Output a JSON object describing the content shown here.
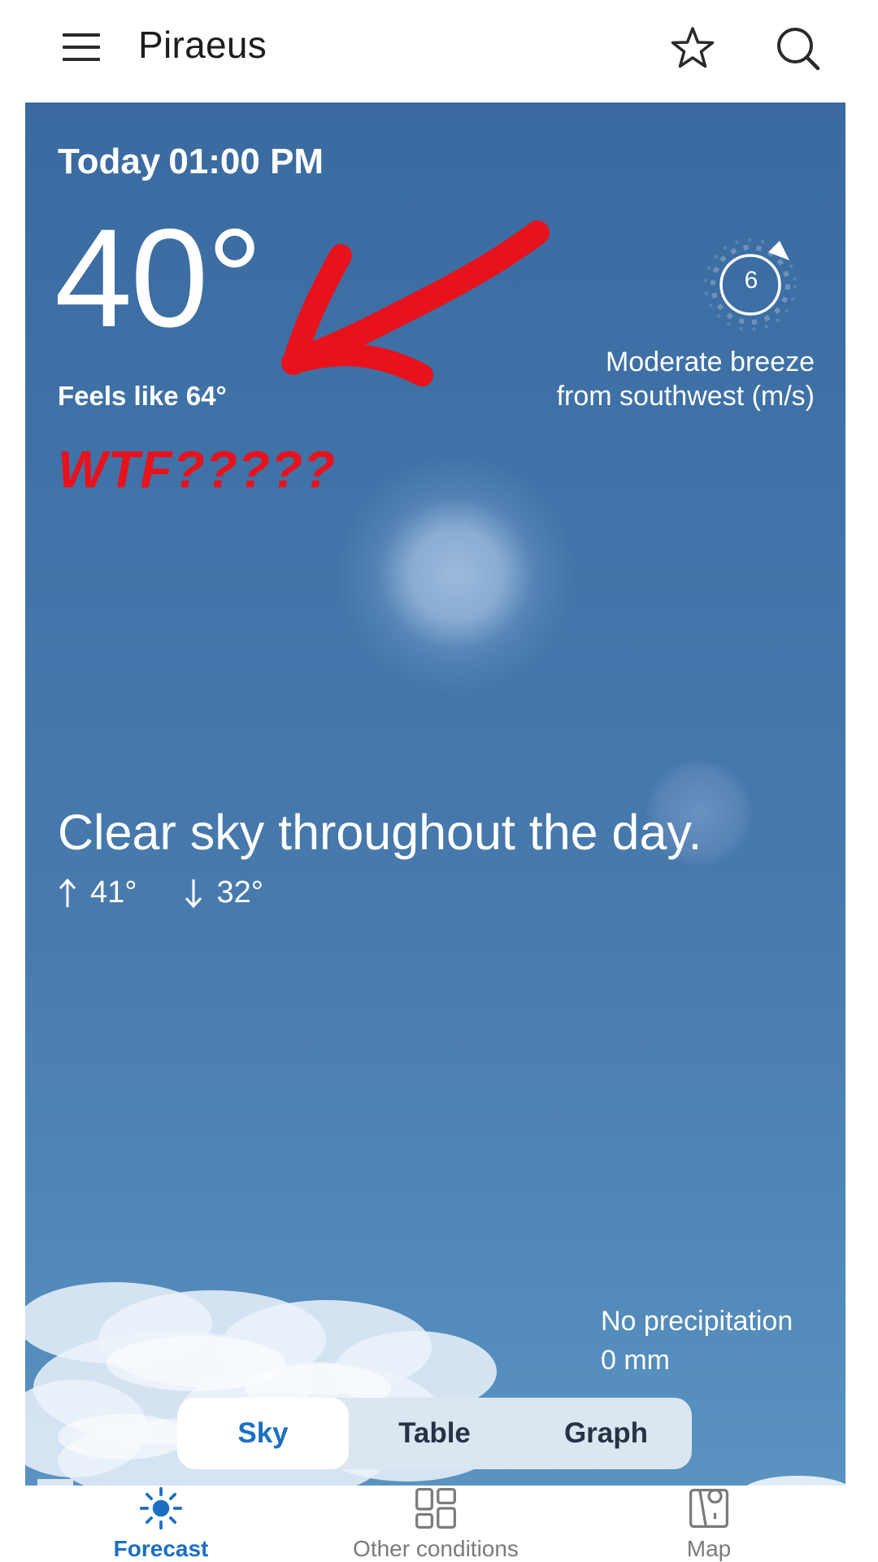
{
  "header": {
    "location": "Piraeus",
    "menu_icon": "hamburger-menu-icon",
    "favorite_icon": "star-outline-icon",
    "search_icon": "search-icon"
  },
  "current": {
    "day": "Today",
    "time": "01:00 PM",
    "temperature": "40°",
    "feels_like": "Feels like 64°",
    "wind": {
      "speed": "6",
      "description_line1": "Moderate breeze",
      "description_line2": "from southwest (m/s)"
    }
  },
  "annotation": {
    "text": "WTF?????",
    "color": "#e8121c"
  },
  "summary": {
    "text": "Clear sky throughout the day.",
    "high": "41°",
    "low": "32°"
  },
  "precipitation": {
    "line1": "No precipitation",
    "line2": "0 mm"
  },
  "view_tabs": {
    "items": [
      "Sky",
      "Table",
      "Graph"
    ],
    "selected": "Sky"
  },
  "bottom_nav": {
    "items": [
      {
        "label": "Forecast",
        "icon": "sun-icon"
      },
      {
        "label": "Other conditions",
        "icon": "grid-icon"
      },
      {
        "label": "Map",
        "icon": "map-pin-icon"
      }
    ],
    "selected": "Forecast"
  },
  "colors": {
    "accent": "#1b6fc2",
    "panel_top": "#3a6aa0",
    "panel_bottom": "#5a93c1",
    "annotation_red": "#e8121c"
  }
}
